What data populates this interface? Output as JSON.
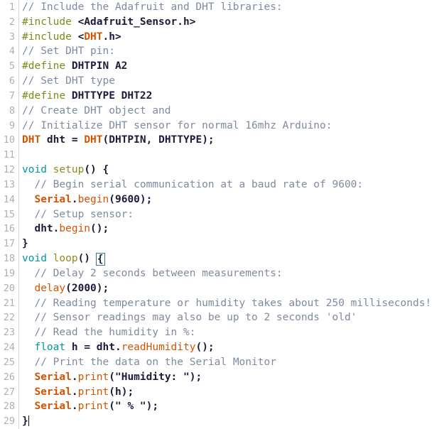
{
  "editor": {
    "name": "arduino-code-editor",
    "language": "arduino-cpp",
    "total_lines": 29,
    "colors": {
      "background": "#FFFFFF",
      "gutter_text": "#AFAFAF",
      "gutter_rule": "#D6D6D6",
      "comment": "#7E8AA2",
      "preprocessor": "#7A8B1A",
      "keyword": "#00979C",
      "function_name": "#8F8C1E",
      "library_class": "#D35400",
      "method": "#D35400",
      "plain_text": "#1B1B3A",
      "brace_match_outline": "#2E7D8C",
      "caret": "#111111"
    },
    "caret": {
      "line": 29,
      "after_text": "}"
    },
    "brace_match": {
      "line": 18,
      "char": "{"
    }
  },
  "lines": [
    {
      "n": "1",
      "tokens": [
        {
          "t": "comment",
          "v": "// Include the Adafruit and DHT libraries:"
        }
      ]
    },
    {
      "n": "2",
      "tokens": [
        {
          "t": "pre",
          "v": "#include"
        },
        {
          "t": "plain",
          "v": " <Adafruit_Sensor.h>"
        }
      ]
    },
    {
      "n": "3",
      "tokens": [
        {
          "t": "pre",
          "v": "#include"
        },
        {
          "t": "plain",
          "v": " <"
        },
        {
          "t": "lib",
          "v": "DHT"
        },
        {
          "t": "plain",
          "v": ".h>"
        }
      ]
    },
    {
      "n": "4",
      "tokens": [
        {
          "t": "comment",
          "v": "// Set DHT pin:"
        }
      ]
    },
    {
      "n": "5",
      "tokens": [
        {
          "t": "pre",
          "v": "#define"
        },
        {
          "t": "plain",
          "v": " DHTPIN A2"
        }
      ]
    },
    {
      "n": "6",
      "tokens": [
        {
          "t": "comment",
          "v": "// Set DHT type"
        }
      ]
    },
    {
      "n": "7",
      "tokens": [
        {
          "t": "pre",
          "v": "#define"
        },
        {
          "t": "plain",
          "v": " DHTTYPE DHT22"
        }
      ]
    },
    {
      "n": "8",
      "tokens": [
        {
          "t": "comment",
          "v": "// Create DHT object and"
        }
      ]
    },
    {
      "n": "9",
      "tokens": [
        {
          "t": "comment",
          "v": "// Initialize DHT sensor for normal 16mhz Arduino:"
        }
      ]
    },
    {
      "n": "10",
      "tokens": [
        {
          "t": "lib",
          "v": "DHT"
        },
        {
          "t": "plain",
          "v": " dht = "
        },
        {
          "t": "lib",
          "v": "DHT"
        },
        {
          "t": "plain",
          "v": "(DHTPIN, DHTTYPE);"
        }
      ]
    },
    {
      "n": "11",
      "tokens": []
    },
    {
      "n": "12",
      "tokens": [
        {
          "t": "keyword",
          "v": "void"
        },
        {
          "t": "plain",
          "v": " "
        },
        {
          "t": "func",
          "v": "setup"
        },
        {
          "t": "plain",
          "v": "() {"
        }
      ]
    },
    {
      "n": "13",
      "tokens": [
        {
          "t": "plain",
          "v": "  "
        },
        {
          "t": "comment",
          "v": "// Begin serial communication at a baud rate of 9600:"
        }
      ]
    },
    {
      "n": "14",
      "tokens": [
        {
          "t": "plain",
          "v": "  "
        },
        {
          "t": "lib",
          "v": "Serial"
        },
        {
          "t": "plain",
          "v": "."
        },
        {
          "t": "method",
          "v": "begin"
        },
        {
          "t": "plain",
          "v": "(9600);"
        }
      ]
    },
    {
      "n": "15",
      "tokens": [
        {
          "t": "plain",
          "v": "  "
        },
        {
          "t": "comment",
          "v": "// Setup sensor:"
        }
      ]
    },
    {
      "n": "16",
      "tokens": [
        {
          "t": "plain",
          "v": "  dht."
        },
        {
          "t": "method",
          "v": "begin"
        },
        {
          "t": "plain",
          "v": "();"
        }
      ]
    },
    {
      "n": "17",
      "tokens": [
        {
          "t": "plain",
          "v": "}"
        }
      ]
    },
    {
      "n": "18",
      "tokens": [
        {
          "t": "keyword",
          "v": "void"
        },
        {
          "t": "plain",
          "v": " "
        },
        {
          "t": "func",
          "v": "loop"
        },
        {
          "t": "plain",
          "v": "() "
        },
        {
          "t": "brace",
          "v": "{"
        }
      ]
    },
    {
      "n": "19",
      "tokens": [
        {
          "t": "plain",
          "v": "  "
        },
        {
          "t": "comment",
          "v": "// Delay 2 seconds between measurements:"
        }
      ]
    },
    {
      "n": "20",
      "tokens": [
        {
          "t": "plain",
          "v": "  "
        },
        {
          "t": "method",
          "v": "delay"
        },
        {
          "t": "plain",
          "v": "(2000);"
        }
      ]
    },
    {
      "n": "21",
      "tokens": [
        {
          "t": "plain",
          "v": "  "
        },
        {
          "t": "comment",
          "v": "// Reading temperature or humidity takes about 250 milliseconds!"
        }
      ]
    },
    {
      "n": "22",
      "tokens": [
        {
          "t": "plain",
          "v": "  "
        },
        {
          "t": "comment",
          "v": "// Sensor readings may also be up to 2 seconds 'old'"
        }
      ]
    },
    {
      "n": "23",
      "tokens": [
        {
          "t": "plain",
          "v": "  "
        },
        {
          "t": "comment",
          "v": "// Read the humidity in %:"
        }
      ]
    },
    {
      "n": "24",
      "tokens": [
        {
          "t": "plain",
          "v": "  "
        },
        {
          "t": "keyword",
          "v": "float"
        },
        {
          "t": "plain",
          "v": " h = dht."
        },
        {
          "t": "method",
          "v": "readHumidity"
        },
        {
          "t": "plain",
          "v": "();"
        }
      ]
    },
    {
      "n": "25",
      "tokens": [
        {
          "t": "plain",
          "v": "  "
        },
        {
          "t": "comment",
          "v": "// Print the data on the Serial Monitor"
        }
      ]
    },
    {
      "n": "26",
      "tokens": [
        {
          "t": "plain",
          "v": "  "
        },
        {
          "t": "lib",
          "v": "Serial"
        },
        {
          "t": "plain",
          "v": "."
        },
        {
          "t": "method",
          "v": "print"
        },
        {
          "t": "plain",
          "v": "(\"Humidity: \");"
        }
      ]
    },
    {
      "n": "27",
      "tokens": [
        {
          "t": "plain",
          "v": "  "
        },
        {
          "t": "lib",
          "v": "Serial"
        },
        {
          "t": "plain",
          "v": "."
        },
        {
          "t": "method",
          "v": "print"
        },
        {
          "t": "plain",
          "v": "(h);"
        }
      ]
    },
    {
      "n": "28",
      "tokens": [
        {
          "t": "plain",
          "v": "  "
        },
        {
          "t": "lib",
          "v": "Serial"
        },
        {
          "t": "plain",
          "v": "."
        },
        {
          "t": "method",
          "v": "print"
        },
        {
          "t": "plain",
          "v": "(\" % \");"
        }
      ]
    },
    {
      "n": "29",
      "tokens": [
        {
          "t": "plain",
          "v": "}"
        },
        {
          "t": "caret",
          "v": ""
        }
      ]
    }
  ]
}
